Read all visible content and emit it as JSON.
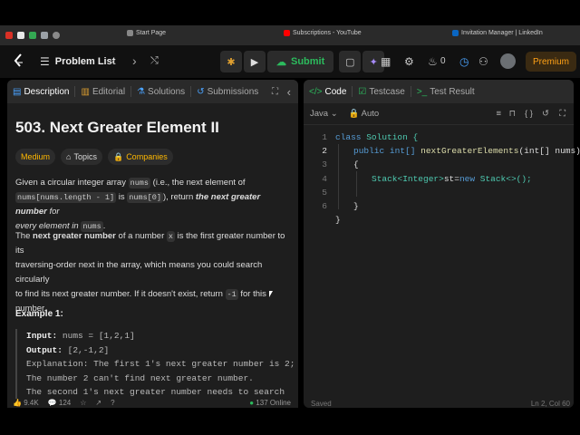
{
  "browser": {
    "tabs": [
      {
        "label": "Start Page",
        "color": "#888888"
      },
      {
        "label": "Subscriptions - YouTube",
        "color": "#ff0000"
      },
      {
        "label": "Invitation Manager | LinkedIn",
        "color": "#0a66c2"
      }
    ],
    "extension_colors": [
      "#d93025",
      "#e8e8e8",
      "#34a853",
      "#9aa0a6",
      "#8a8a8a"
    ]
  },
  "topbar": {
    "logo_icon": "leetcode-logo",
    "problem_list_label": "Problem List",
    "submit_label": "Submit",
    "streak_count": "0",
    "premium_label": "Premium"
  },
  "left_panel": {
    "tabs": [
      {
        "label": "Description",
        "icon": "description-icon",
        "active": true
      },
      {
        "label": "Editorial",
        "icon": "book-icon",
        "active": false
      },
      {
        "label": "Solutions",
        "icon": "flask-icon",
        "active": false
      },
      {
        "label": "Submissions",
        "icon": "history-icon",
        "active": false
      }
    ],
    "title": "503. Next Greater Element II",
    "tags": {
      "difficulty": "Medium",
      "topics": "Topics",
      "companies": "Companies"
    },
    "desc": {
      "p1_a": "Given a circular integer array ",
      "p1_code1": "nums",
      "p1_b": " (i.e., the next element of",
      "p1_code2": "nums[nums.length - 1]",
      "p1_c": " is ",
      "p1_code3": "nums[0]",
      "p1_d": "), return ",
      "p1_e": "the next greater number",
      "p1_f": " for",
      "p1_g": "every element in",
      "p1_code4": "nums",
      "p1_h": ".",
      "p2_a": "The ",
      "p2_b": "next greater number",
      "p2_c": " of a number ",
      "p2_code1": "x",
      "p2_d": " is the first greater number to its",
      "p2_e": "traversing-order next in the array, which means you could search circularly",
      "p2_f": "to find its next greater number. If it doesn't exist, return ",
      "p2_code2": "-1",
      "p2_g": " for this number."
    },
    "example_title": "Example 1:",
    "example": {
      "input_label": "Input:",
      "input_value": " nums = [1,2,1]",
      "output_label": "Output:",
      "output_value": " [2,-1,2]",
      "explanation1": "Explanation: The first 1's next greater number is 2;",
      "explanation2": "The number 2 can't find next greater number.",
      "explanation3": "The second 1's next greater number needs to search"
    },
    "footer": {
      "likes": "9.4K",
      "comments": "124",
      "online": "137 Online"
    }
  },
  "right_panel": {
    "tabs": [
      {
        "label": "Code",
        "active": true
      },
      {
        "label": "Testcase",
        "active": false
      },
      {
        "label": "Test Result",
        "active": false
      }
    ],
    "language": "Java",
    "mode": "Auto",
    "line_numbers": [
      "1",
      "2",
      "3",
      "4",
      "5",
      "6"
    ],
    "code": {
      "l1_kw": "class",
      "l1_name": " Solution {",
      "l2_kw": "public",
      "l2_type": " int[] ",
      "l2_fn": "nextGreaterElements",
      "l2_rest": "(int[] nums)",
      "l3": "{",
      "l4_type": "Stack<Integer>",
      "l4_rest": "st=",
      "l4_kw": "new",
      "l4_end": " Stack<>();",
      "l5": "}",
      "l6": "}"
    },
    "footer": {
      "saved": "Saved",
      "position": "Ln 2, Col 60"
    }
  }
}
